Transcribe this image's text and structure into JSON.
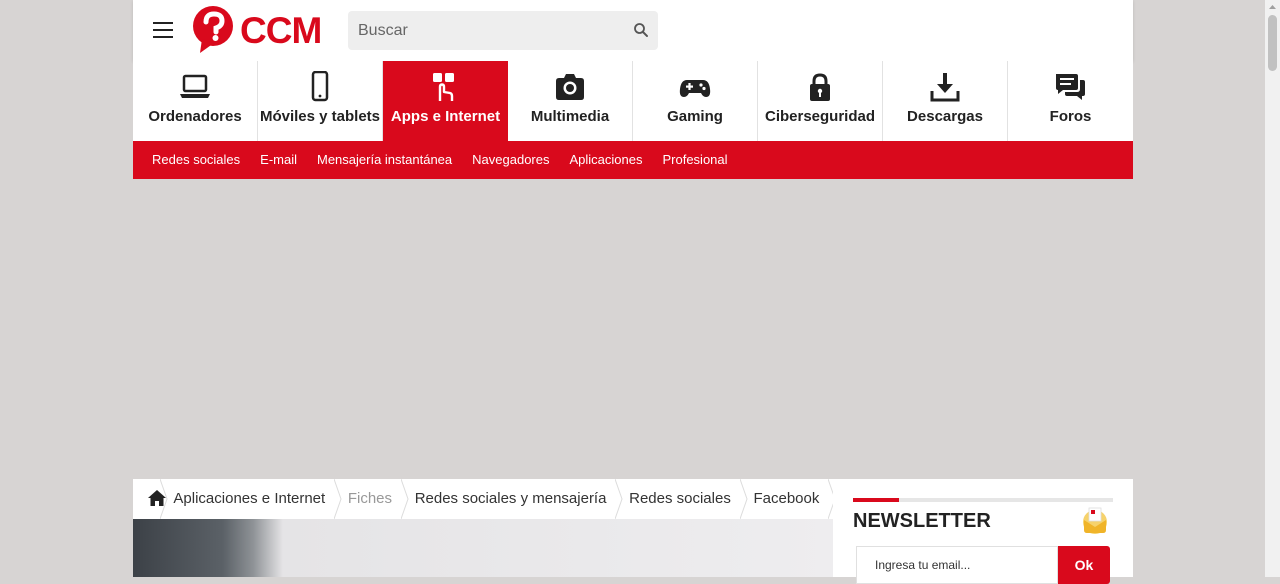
{
  "header": {
    "logo_text": "CCM",
    "search_placeholder": "Buscar"
  },
  "categories": [
    {
      "label": "Ordenadores",
      "icon": "laptop-icon",
      "active": false
    },
    {
      "label": "Móviles y tablets",
      "icon": "smartphone-icon",
      "active": false
    },
    {
      "label": "Apps e Internet",
      "icon": "touch-apps-icon",
      "active": true
    },
    {
      "label": "Multimedia",
      "icon": "camera-icon",
      "active": false
    },
    {
      "label": "Gaming",
      "icon": "gamepad-icon",
      "active": false
    },
    {
      "label": "Ciberseguridad",
      "icon": "lock-icon",
      "active": false
    },
    {
      "label": "Descargas",
      "icon": "download-icon",
      "active": false
    },
    {
      "label": "Foros",
      "icon": "chat-bubbles-icon",
      "active": false
    }
  ],
  "subnav": [
    "Redes sociales",
    "E-mail",
    "Mensajería instantánea",
    "Navegadores",
    "Aplicaciones",
    "Profesional"
  ],
  "breadcrumb": {
    "items": [
      {
        "label": "Aplicaciones e Internet",
        "muted": false
      },
      {
        "label": "Fiches",
        "muted": true
      },
      {
        "label": "Redes sociales y mensajería",
        "muted": false
      },
      {
        "label": "Redes sociales",
        "muted": false
      },
      {
        "label": "Facebook",
        "muted": false
      }
    ]
  },
  "newsletter": {
    "title": "NEWSLETTER",
    "email_placeholder": "Ingresa tu email...",
    "submit_label": "Ok"
  },
  "colors": {
    "brand_red": "#d9091c",
    "page_background": "#d7d4d3"
  }
}
